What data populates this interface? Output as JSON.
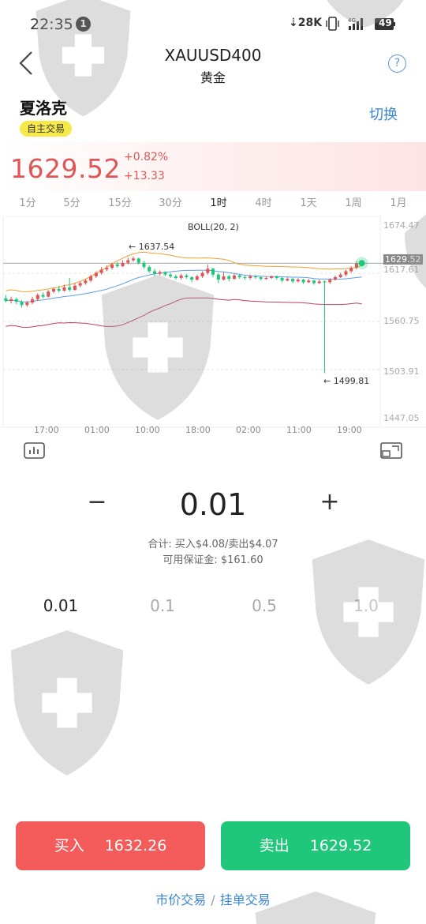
{
  "status_bar": {
    "time": "22:35",
    "notification_count": "1",
    "net_speed": "28K",
    "battery": "49"
  },
  "header": {
    "symbol": "XAUUSD400",
    "name": "黄金"
  },
  "account": {
    "name": "夏洛克",
    "tag": "自主交易",
    "switch_label": "切换"
  },
  "quote": {
    "price": "1629.52",
    "change_pct": "+0.82%",
    "change_abs": "+13.33"
  },
  "timeframes": [
    "1分",
    "5分",
    "15分",
    "30分",
    "1时",
    "4时",
    "1天",
    "1周",
    "1月"
  ],
  "active_timeframe": "1时",
  "chart_data": {
    "type": "candlestick",
    "indicator": "BOLL(20, 2)",
    "y_ticks": [
      "1674.47",
      "1617.61",
      "1560.75",
      "1503.91",
      "1447.05"
    ],
    "y_range": [
      1447.05,
      1674.47
    ],
    "current_price_label": "1629.52",
    "x_ticks": [
      "17:00",
      "01:00",
      "10:00",
      "18:00",
      "02:00",
      "11:00",
      "19:00"
    ],
    "high_annotation": "← 1637.54",
    "low_annotation": "← 1499.81",
    "high_value": 1637.54,
    "low_value": 1499.81,
    "colors": {
      "up": "#e05555",
      "down": "#1ec77a",
      "upper_band": "#f0a030",
      "mid_band": "#5ba0e0",
      "lower_band": "#c04060"
    },
    "candles": [
      [
        1588,
        1585,
        1592,
        1583
      ],
      [
        1585,
        1587,
        1590,
        1582
      ],
      [
        1587,
        1584,
        1589,
        1581
      ],
      [
        1584,
        1580,
        1586,
        1577
      ],
      [
        1580,
        1583,
        1585,
        1578
      ],
      [
        1583,
        1587,
        1590,
        1581
      ],
      [
        1587,
        1592,
        1594,
        1585
      ],
      [
        1592,
        1590,
        1595,
        1588
      ],
      [
        1590,
        1596,
        1598,
        1589
      ],
      [
        1596,
        1599,
        1601,
        1594
      ],
      [
        1599,
        1597,
        1603,
        1595
      ],
      [
        1597,
        1601,
        1604,
        1596
      ],
      [
        1601,
        1598,
        1612,
        1596
      ],
      [
        1598,
        1603,
        1606,
        1597
      ],
      [
        1603,
        1606,
        1608,
        1601
      ],
      [
        1606,
        1609,
        1611,
        1604
      ],
      [
        1609,
        1614,
        1616,
        1607
      ],
      [
        1614,
        1618,
        1620,
        1612
      ],
      [
        1618,
        1622,
        1625,
        1616
      ],
      [
        1622,
        1624,
        1627,
        1620
      ],
      [
        1624,
        1628,
        1630,
        1622
      ],
      [
        1628,
        1626,
        1631,
        1624
      ],
      [
        1626,
        1630,
        1633,
        1625
      ],
      [
        1630,
        1633,
        1636,
        1628
      ],
      [
        1633,
        1635,
        1637.5,
        1631
      ],
      [
        1635,
        1630,
        1636,
        1628
      ],
      [
        1630,
        1625,
        1632,
        1623
      ],
      [
        1625,
        1620,
        1627,
        1618
      ],
      [
        1620,
        1617,
        1623,
        1614
      ],
      [
        1617,
        1619,
        1621,
        1615
      ],
      [
        1619,
        1616,
        1620,
        1614
      ],
      [
        1616,
        1614,
        1618,
        1612
      ],
      [
        1614,
        1612,
        1616,
        1610
      ],
      [
        1612,
        1615,
        1617,
        1610
      ],
      [
        1615,
        1613,
        1617,
        1611
      ],
      [
        1613,
        1610,
        1614,
        1607
      ],
      [
        1610,
        1614,
        1616,
        1609
      ],
      [
        1614,
        1618,
        1620,
        1612
      ],
      [
        1618,
        1623,
        1628,
        1616
      ],
      [
        1623,
        1616,
        1624,
        1613
      ],
      [
        1616,
        1610,
        1618,
        1606
      ],
      [
        1610,
        1614,
        1619,
        1609
      ],
      [
        1614,
        1611,
        1616,
        1608
      ],
      [
        1611,
        1615,
        1617,
        1610
      ],
      [
        1615,
        1613,
        1617,
        1611
      ],
      [
        1613,
        1612,
        1615,
        1610
      ],
      [
        1612,
        1614,
        1616,
        1610
      ],
      [
        1614,
        1613,
        1615,
        1611
      ],
      [
        1613,
        1611,
        1614,
        1609
      ],
      [
        1611,
        1612,
        1614,
        1610
      ],
      [
        1612,
        1614,
        1615,
        1611
      ],
      [
        1614,
        1612,
        1615,
        1610
      ],
      [
        1612,
        1609,
        1613,
        1607
      ],
      [
        1609,
        1611,
        1613,
        1608
      ],
      [
        1611,
        1608,
        1612,
        1606
      ],
      [
        1608,
        1610,
        1612,
        1607
      ],
      [
        1610,
        1607,
        1611,
        1605
      ],
      [
        1607,
        1609,
        1611,
        1606
      ],
      [
        1609,
        1606,
        1610,
        1604
      ],
      [
        1606,
        1608,
        1610,
        1605
      ],
      [
        1608,
        1607,
        1609,
        1499.81
      ],
      [
        1607,
        1610,
        1612,
        1605
      ],
      [
        1610,
        1613,
        1615,
        1609
      ],
      [
        1613,
        1616,
        1618,
        1612
      ],
      [
        1616,
        1620,
        1622,
        1614
      ],
      [
        1620,
        1624,
        1626,
        1618
      ],
      [
        1624,
        1629,
        1632,
        1622
      ],
      [
        1629,
        1629.52,
        1633,
        1627
      ]
    ]
  },
  "quantity": {
    "minus": "−",
    "value": "0.01",
    "plus": "+",
    "total_line": "合计: 买入$4.08/卖出$4.07",
    "margin_line": "可用保证金: $161.60",
    "presets": [
      "0.01",
      "0.1",
      "0.5",
      "1.0"
    ],
    "active_preset": "0.01"
  },
  "actions": {
    "buy_label": "买入",
    "buy_price": "1632.26",
    "sell_label": "卖出",
    "sell_price": "1629.52",
    "market_order": "市价交易",
    "separator": "/",
    "pending_order": "挂单交易"
  }
}
